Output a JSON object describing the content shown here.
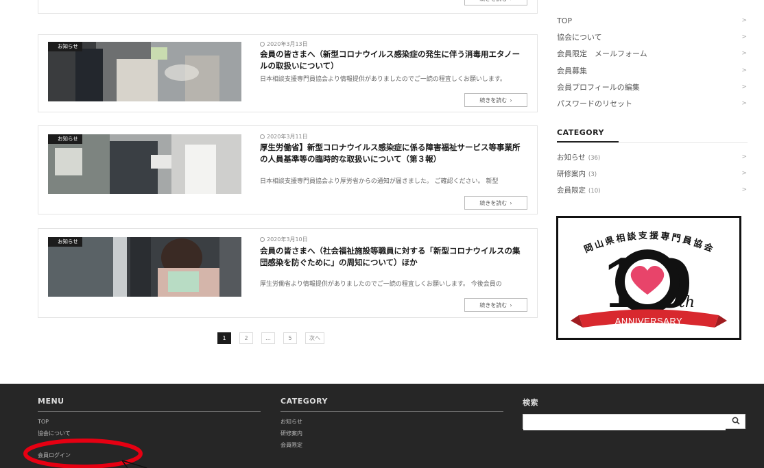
{
  "posts": {
    "more_label": "続きを読む",
    "items": [
      {
        "badge": "お知らせ",
        "date": "2020年3月13日",
        "title": "会員の皆さまへ（新型コロナウイルス感染症の発生に伴う消毒用エタノールの取扱いについて）",
        "excerpt": "日本相談支援専門員協会より情報提供がありましたのでご一読の程宜しくお願いします。"
      },
      {
        "badge": "お知らせ",
        "date": "2020年3月11日",
        "title": "厚生労働省】新型コロナウイルス感染症に係る障害福祉サービス等事業所の人員基準等の臨時的な取扱いについて（第３報）",
        "excerpt": "日本相談支援専門員協会より厚労省からの通知が届きました。 ご確認ください。 新型"
      },
      {
        "badge": "お知らせ",
        "date": "2020年3月10日",
        "title": "会員の皆さまへ（社会福祉施設等職員に対する「新型コロナウイルスの集団感染を防ぐために」の周知について）ほか",
        "excerpt": "厚生労働省より情報提供がありましたのでご一読の程宜しくお願いします。 今後会員の"
      }
    ]
  },
  "pagination": {
    "pages": [
      "1",
      "2",
      "…",
      "5"
    ],
    "next": "次へ",
    "current": "1"
  },
  "sidebar": {
    "menu": [
      "TOP",
      "協会について",
      "会員限定　メールフォーム",
      "会員募集",
      "会員プロフィールの編集",
      "パスワードのリセット"
    ],
    "category_heading": "CATEGORY",
    "categories": [
      {
        "label": "お知らせ",
        "count": "(36)"
      },
      {
        "label": "研修案内",
        "count": "(3)"
      },
      {
        "label": "会員限定",
        "count": "(10)"
      }
    ],
    "logo": {
      "org": "岡山県相談支援専門員協会",
      "number": "10",
      "suffix": "th",
      "ribbon": "ANNIVERSARY"
    }
  },
  "footer": {
    "menu_heading": "MENU",
    "menu": [
      "TOP",
      "協会について",
      "会員ログイン"
    ],
    "category_heading": "CATEGORY",
    "categories": [
      "お知らせ",
      "研修案内",
      "会員限定"
    ],
    "search_heading": "検索",
    "search_placeholder": ""
  },
  "colors": {
    "annotation": "#e60012",
    "footer_bg": "#262626",
    "badge_bg": "#1c1c1c"
  }
}
